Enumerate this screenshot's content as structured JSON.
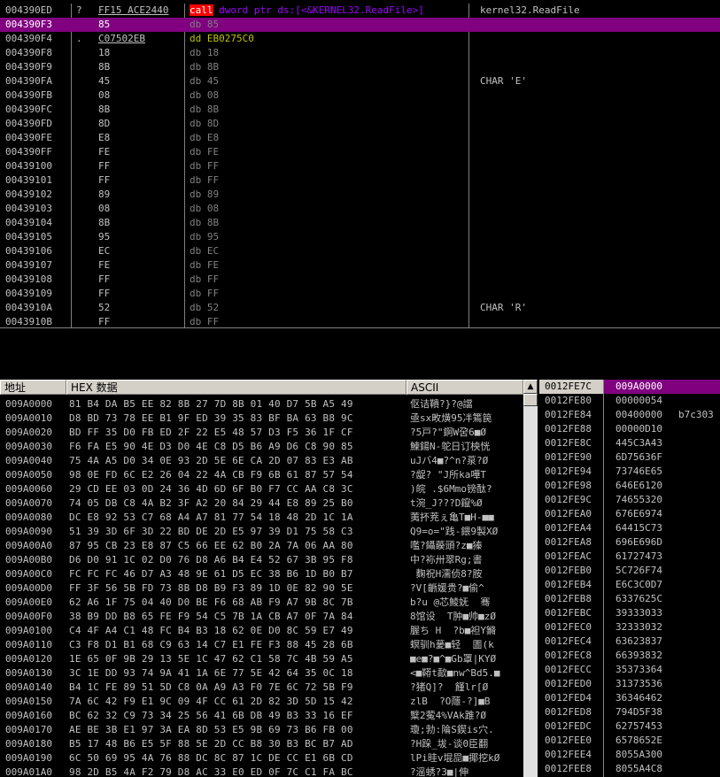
{
  "disasm": {
    "rows": [
      {
        "addr": "004390ED",
        "mark": "?",
        "hex": "FF15 ACE2440",
        "dis_kind": "call",
        "dis": "call",
        "dis_rest": " dword ptr ds:[<&KERNEL32.ReadFile>]",
        "comment": "kernel32.ReadFile",
        "sel": false
      },
      {
        "addr": "004390F3",
        "mark": "",
        "hex": "85",
        "dis_kind": "db",
        "dis": "db 85",
        "dis_rest": "",
        "comment": "",
        "sel": true
      },
      {
        "addr": "004390F4",
        "mark": ".",
        "hex": "C07502EB",
        "dis_kind": "dd",
        "dis": "dd EB0275C0",
        "dis_rest": "",
        "comment": "",
        "sel": false
      },
      {
        "addr": "004390F8",
        "mark": "",
        "hex": "18",
        "dis_kind": "db",
        "dis": "db 18",
        "dis_rest": "",
        "comment": "",
        "sel": false
      },
      {
        "addr": "004390F9",
        "mark": "",
        "hex": "8B",
        "dis_kind": "db",
        "dis": "db 8B",
        "dis_rest": "",
        "comment": "",
        "sel": false
      },
      {
        "addr": "004390FA",
        "mark": "",
        "hex": "45",
        "dis_kind": "db",
        "dis": "db 45",
        "dis_rest": "",
        "comment": "CHAR 'E'",
        "sel": false
      },
      {
        "addr": "004390FB",
        "mark": "",
        "hex": "08",
        "dis_kind": "db",
        "dis": "db 08",
        "dis_rest": "",
        "comment": "",
        "sel": false
      },
      {
        "addr": "004390FC",
        "mark": "",
        "hex": "8B",
        "dis_kind": "db",
        "dis": "db 8B",
        "dis_rest": "",
        "comment": "",
        "sel": false
      },
      {
        "addr": "004390FD",
        "mark": "",
        "hex": "8D",
        "dis_kind": "db",
        "dis": "db 8D",
        "dis_rest": "",
        "comment": "",
        "sel": false
      },
      {
        "addr": "004390FE",
        "mark": "",
        "hex": "E8",
        "dis_kind": "db",
        "dis": "db E8",
        "dis_rest": "",
        "comment": "",
        "sel": false
      },
      {
        "addr": "004390FF",
        "mark": "",
        "hex": "FE",
        "dis_kind": "db",
        "dis": "db FE",
        "dis_rest": "",
        "comment": "",
        "sel": false
      },
      {
        "addr": "00439100",
        "mark": "",
        "hex": "FF",
        "dis_kind": "db",
        "dis": "db FF",
        "dis_rest": "",
        "comment": "",
        "sel": false
      },
      {
        "addr": "00439101",
        "mark": "",
        "hex": "FF",
        "dis_kind": "db",
        "dis": "db FF",
        "dis_rest": "",
        "comment": "",
        "sel": false
      },
      {
        "addr": "00439102",
        "mark": "",
        "hex": "89",
        "dis_kind": "db",
        "dis": "db 89",
        "dis_rest": "",
        "comment": "",
        "sel": false
      },
      {
        "addr": "00439103",
        "mark": "",
        "hex": "08",
        "dis_kind": "db",
        "dis": "db 08",
        "dis_rest": "",
        "comment": "",
        "sel": false
      },
      {
        "addr": "00439104",
        "mark": "",
        "hex": "8B",
        "dis_kind": "db",
        "dis": "db 8B",
        "dis_rest": "",
        "comment": "",
        "sel": false
      },
      {
        "addr": "00439105",
        "mark": "",
        "hex": "95",
        "dis_kind": "db",
        "dis": "db 95",
        "dis_rest": "",
        "comment": "",
        "sel": false
      },
      {
        "addr": "00439106",
        "mark": "",
        "hex": "EC",
        "dis_kind": "db",
        "dis": "db EC",
        "dis_rest": "",
        "comment": "",
        "sel": false
      },
      {
        "addr": "00439107",
        "mark": "",
        "hex": "FE",
        "dis_kind": "db",
        "dis": "db FE",
        "dis_rest": "",
        "comment": "",
        "sel": false
      },
      {
        "addr": "00439108",
        "mark": "",
        "hex": "FF",
        "dis_kind": "db",
        "dis": "db FF",
        "dis_rest": "",
        "comment": "",
        "sel": false
      },
      {
        "addr": "00439109",
        "mark": "",
        "hex": "FF",
        "dis_kind": "db",
        "dis": "db FF",
        "dis_rest": "",
        "comment": "",
        "sel": false
      },
      {
        "addr": "0043910A",
        "mark": "",
        "hex": "52",
        "dis_kind": "db",
        "dis": "db 52",
        "dis_rest": "",
        "comment": "CHAR 'R'",
        "sel": false
      },
      {
        "addr": "0043910B",
        "mark": "",
        "hex": "FF",
        "dis_kind": "db",
        "dis": "db FF",
        "dis_rest": "",
        "comment": "",
        "sel": false
      }
    ]
  },
  "dump": {
    "headers": {
      "address": "地址",
      "hex": "HEX 数据",
      "ascii": "ASCII"
    },
    "rows": [
      {
        "addr": "009A0000",
        "hex": "81 B4 DA B5 EE 82 8B 27 7D 8B 01 40 D7 5B A5 49",
        "ascii": "伛诘鞼?}?@譡"
      },
      {
        "addr": "009A0010",
        "hex": "D8 BD 73 78 EE B1 9F ED 39 35 83 BF BA 63 B8 9C",
        "ascii": "亟sx畋熿95冸篶笢"
      },
      {
        "addr": "009A0020",
        "hex": "BD FF 35 D0 FB ED 2F 22 E5 48 57 D3 F5 36 1F CF",
        "ascii": "?5戸?\"錒W呄6■Ø"
      },
      {
        "addr": "009A0030",
        "hex": "F6 FA E5 90 4E D3 D0 4E C8 D5 B6 A9 D6 C8 90 85",
        "ascii": "鰊鍚N-鸵日订柍恍"
      },
      {
        "addr": "009A0040",
        "hex": "75 4A A5 D0 34 0E 93 2D 5E 6E CA 2D 07 83 E3 AB",
        "ascii": "uJバ4■?^n?葲?Ø"
      },
      {
        "addr": "009A0050",
        "hex": "98 0E FD 6C E2 26 04 22 4A CB F9 6B 61 87 57 54",
        "ascii": "?龊? \"J所ka嘩T"
      },
      {
        "addr": "009A0060",
        "hex": "29 CD EE 03 0D 24 36 4D 6D 6F B0 F7 CC AA C8 3C",
        "ascii": ")皖 .$6Mmo镑酞?"
      },
      {
        "addr": "009A0070",
        "hex": "74 05 DB C8 4A B2 3F A2 20 84 29 44 E8 89 25 B0",
        "ascii": "t涴_J???D鑹%Ø"
      },
      {
        "addr": "009A0080",
        "hex": "DC E8 92 53 C7 68 A4 A7 81 77 54 18 48 2D 1C 1A",
        "ascii": "荑抔茺ぇ亀T■H-■■"
      },
      {
        "addr": "009A0090",
        "hex": "51 39 3D 6F 3D 22 BD DE 2D E5 97 39 D1 75 58 C3",
        "ascii": "Q9=o=\"践-鍡9製XØ"
      },
      {
        "addr": "009A00A0",
        "hex": "87 95 CB 23 E8 87 C5 66 EE 62 B0 2A 7A 06 AA 80",
        "ascii": "嚂?鑷藈頭?z■獉"
      },
      {
        "addr": "009A00B0",
        "hex": "D6 D0 91 1C 02 D0 76 D8 A6 B4 E4 52 67 3B 95 F8",
        "ascii": "中?袮卅翠Rg;書"
      },
      {
        "addr": "009A00C0",
        "hex": "FC FC FC 46 D7 A3 48 9E 61 D5 EC 38 B6 1D B0 B7",
        "ascii": " 麴祝H濡侦8?胺"
      },
      {
        "addr": "009A00D0",
        "hex": "FF 3F 56 5B FD 73 8B D8 B9 F3 89 1D 0E 82 90 5E",
        "ascii": "?V[齭媛贵?■偷^"
      },
      {
        "addr": "009A00E0",
        "hex": "62 A6 1F 75 04 40 D0 BE F6 68 AB F9 A7 9B 8C 7B",
        "ascii": "b?u @芯鯪妩  骞"
      },
      {
        "addr": "009A00F0",
        "hex": "38 B9 DD B8 65 FE F9 54 C5 7B 1A CB A7 0F 7A 84",
        "ascii": "8馆设  T肿■帅■zØ"
      },
      {
        "addr": "009A0100",
        "hex": "C4 4F A4 C1 48 FC B4 B3 18 62 0E D0 8C 59 E7 49",
        "ascii": "腛ち H  ?b■袒Y鏅"
      },
      {
        "addr": "009A0110",
        "hex": "C3 F8 D1 B1 68 C9 63 14 C7 E1 FE F3 88 45 28 6B",
        "ascii": "螟驯h蓌■轻  圕(k"
      },
      {
        "addr": "009A0120",
        "hex": "1E 65 0F 9B 29 13 5E 1C 47 62 C1 58 7C 4B 59 A5",
        "ascii": "■e■?■^■Gb罩|KYØ"
      },
      {
        "addr": "009A0130",
        "hex": "3C 1E DD 93 74 9A 41 1A 6E 77 5E 42 64 35 0C 18",
        "ascii": "<■鞯t歃■nw^Bd5.■"
      },
      {
        "addr": "009A0140",
        "hex": "B4 1C FE 89 51 5D C8 0A A9 A3 F0 7E 6C 72 5B F9",
        "ascii": "?猪Q]?  饉lr[Ø"
      },
      {
        "addr": "009A0150",
        "hex": "7A 6C 42 F9 E1 9C 09 4F CC 61 2D 82 3D 5D 15 42",
        "ascii": "zlB  ?O蘟-?]■B"
      },
      {
        "addr": "009A0160",
        "hex": "BC 62 32 C9 73 34 25 56 41 6B DB 49 B3 33 16 EF",
        "ascii": "糱2蒬4%VAk踓?Ø"
      },
      {
        "addr": "009A0170",
        "hex": "AE BE 3B E1 97 3A EA 8D 53 E5 9B 69 73 B6 FB 00",
        "ascii": "瓊;勃:陯S鍥is穴."
      },
      {
        "addr": "009A0180",
        "hex": "B5 17 48 B6 E5 5F 88 5E 2D CC B8 30 B3 BC B7 AD",
        "ascii": "?H跺_坺-谈0臣翻"
      },
      {
        "addr": "009A0190",
        "hex": "6C 50 69 95 4A 76 88 DC 8C 87 1C DE CC E1 6B CD",
        "ascii": "lPi晆v堒巼■揶挖kØ"
      },
      {
        "addr": "009A01A0",
        "hex": "98 2D B5 4A F2 79 D8 AC 33 E0 ED 0F 7C C1 FA BC",
        "ascii": "?滛蜏?3■|伸"
      }
    ]
  },
  "stack": {
    "rows": [
      {
        "addr": "0012FE7C",
        "val": "009A0000",
        "comment": "",
        "sel": true
      },
      {
        "addr": "0012FE80",
        "val": "00000054",
        "comment": "",
        "sel": false
      },
      {
        "addr": "0012FE84",
        "val": "00400000",
        "comment": "b7c303",
        "sel": false
      },
      {
        "addr": "0012FE88",
        "val": "00000D10",
        "comment": "",
        "sel": false
      },
      {
        "addr": "0012FE8C",
        "val": "445C3A43",
        "comment": "",
        "sel": false
      },
      {
        "addr": "0012FE90",
        "val": "6D75636F",
        "comment": "",
        "sel": false
      },
      {
        "addr": "0012FE94",
        "val": "73746E65",
        "comment": "",
        "sel": false
      },
      {
        "addr": "0012FE98",
        "val": "646E6120",
        "comment": "",
        "sel": false
      },
      {
        "addr": "0012FE9C",
        "val": "74655320",
        "comment": "",
        "sel": false
      },
      {
        "addr": "0012FEA0",
        "val": "676E6974",
        "comment": "",
        "sel": false
      },
      {
        "addr": "0012FEA4",
        "val": "64415C73",
        "comment": "",
        "sel": false
      },
      {
        "addr": "0012FEA8",
        "val": "696E696D",
        "comment": "",
        "sel": false
      },
      {
        "addr": "0012FEAC",
        "val": "61727473",
        "comment": "",
        "sel": false
      },
      {
        "addr": "0012FEB0",
        "val": "5C726F74",
        "comment": "",
        "sel": false
      },
      {
        "addr": "0012FEB4",
        "val": "E6C3C0D7",
        "comment": "",
        "sel": false
      },
      {
        "addr": "0012FEB8",
        "val": "6337625C",
        "comment": "",
        "sel": false
      },
      {
        "addr": "0012FEBC",
        "val": "39333033",
        "comment": "",
        "sel": false
      },
      {
        "addr": "0012FEC0",
        "val": "32333032",
        "comment": "",
        "sel": false
      },
      {
        "addr": "0012FEC4",
        "val": "63623837",
        "comment": "",
        "sel": false
      },
      {
        "addr": "0012FEC8",
        "val": "66393832",
        "comment": "",
        "sel": false
      },
      {
        "addr": "0012FECC",
        "val": "35373364",
        "comment": "",
        "sel": false
      },
      {
        "addr": "0012FED0",
        "val": "31373536",
        "comment": "",
        "sel": false
      },
      {
        "addr": "0012FED4",
        "val": "36346462",
        "comment": "",
        "sel": false
      },
      {
        "addr": "0012FED8",
        "val": "794D5F38",
        "comment": "",
        "sel": false
      },
      {
        "addr": "0012FEDC",
        "val": "62757453",
        "comment": "",
        "sel": false
      },
      {
        "addr": "0012FEE0",
        "val": "6578652E",
        "comment": "",
        "sel": false
      },
      {
        "addr": "0012FEE4",
        "val": "8055A300",
        "comment": "",
        "sel": false
      },
      {
        "addr": "0012FEE8",
        "val": "8055A4C8",
        "comment": "",
        "sel": false
      }
    ]
  }
}
